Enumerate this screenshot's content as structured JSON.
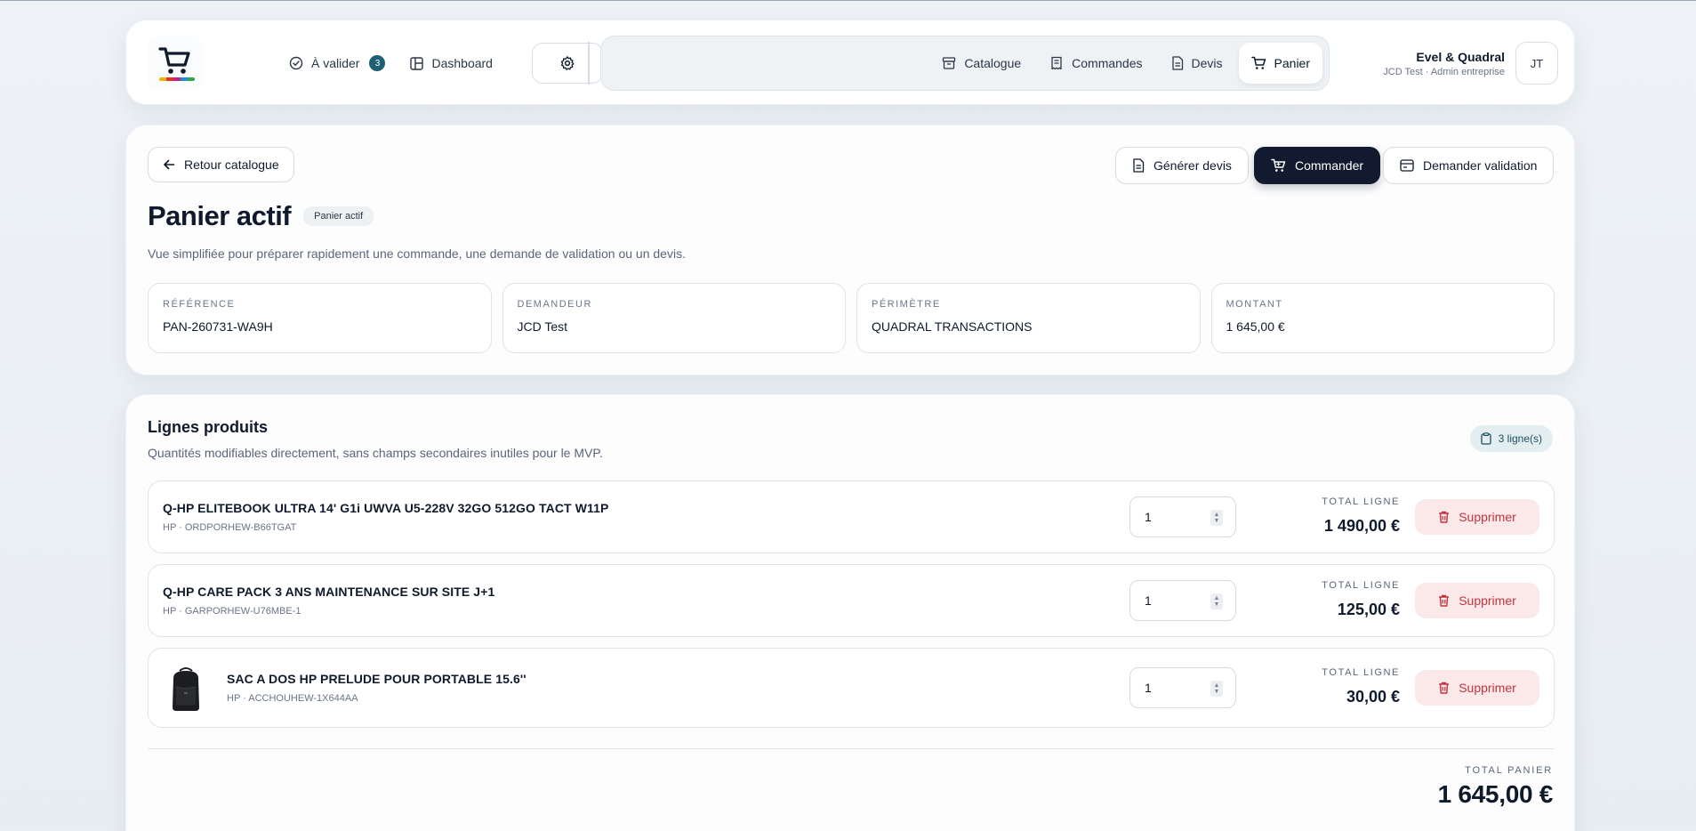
{
  "header": {
    "nav_left": [
      {
        "label": "À valider",
        "badge": "3",
        "icon": "check-circle-icon"
      },
      {
        "label": "Dashboard",
        "icon": "layout-icon"
      }
    ],
    "nav_pill": [
      {
        "label": "Catalogue",
        "icon": "archive-icon",
        "active": false
      },
      {
        "label": "Commandes",
        "icon": "receipt-icon",
        "active": false
      },
      {
        "label": "Devis",
        "icon": "document-icon",
        "active": false
      },
      {
        "label": "Panier",
        "icon": "cart-icon",
        "active": true
      }
    ],
    "user": {
      "name": "Evel & Quadral",
      "sub": "JCD Test · Admin entreprise",
      "initials": "JT"
    },
    "logo_colors": [
      "#f2b300",
      "#e2342b",
      "#c2208a",
      "#1f8fd8",
      "#2aa84a"
    ]
  },
  "cart": {
    "back_label": "Retour catalogue",
    "actions": {
      "quote": "Générer devis",
      "order": "Commander",
      "validate": "Demander validation"
    },
    "title": "Panier actif",
    "status": "Panier actif",
    "subtitle": "Vue simplifiée pour préparer rapidement une commande, une demande de validation ou un devis.",
    "info": [
      {
        "label": "RÉFÉRENCE",
        "value": "PAN-260731-WA9H"
      },
      {
        "label": "DEMANDEUR",
        "value": "JCD Test"
      },
      {
        "label": "PÉRIMÈTRE",
        "value": "QUADRAL TRANSACTIONS"
      },
      {
        "label": "MONTANT",
        "value": "1 645,00 €"
      }
    ]
  },
  "lines": {
    "title": "Lignes produits",
    "subtitle": "Quantités modifiables directement, sans champs secondaires inutiles pour le MVP.",
    "count": "3 ligne(s)",
    "total_line_label": "TOTAL LIGNE",
    "delete_label": "Supprimer",
    "items": [
      {
        "name": "Q-HP ELITEBOOK ULTRA 14' G1i UWVA U5-228V 32GO 512GO TACT W11P",
        "meta": "HP · ORDPORHEW-B66TGAT",
        "qty": "1",
        "total": "1 490,00 €"
      },
      {
        "name": "Q-HP CARE PACK 3 ANS MAINTENANCE SUR SITE J+1",
        "meta": "HP · GARPORHEW-U76MBE-1",
        "qty": "1",
        "total": "125,00 €"
      },
      {
        "name": "SAC A DOS HP PRELUDE POUR PORTABLE 15.6''",
        "meta": "HP · ACCHOUHEW-1X644AA",
        "qty": "1",
        "total": "30,00 €"
      }
    ],
    "total_label": "TOTAL PANIER",
    "total_value": "1 645,00 €"
  }
}
